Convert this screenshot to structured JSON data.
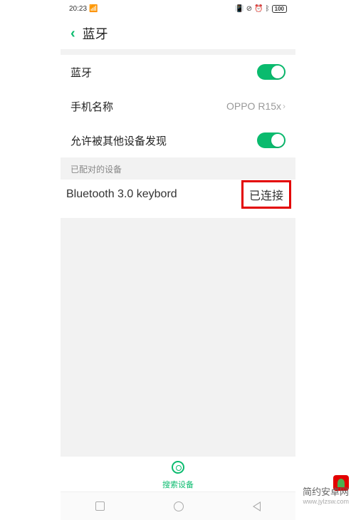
{
  "status_bar": {
    "time": "20:23",
    "battery": "100"
  },
  "header": {
    "title": "蓝牙"
  },
  "settings": {
    "bluetooth_label": "蓝牙",
    "phone_name_label": "手机名称",
    "phone_name_value": "OPPO R15x",
    "discoverable_label": "允许被其他设备发现"
  },
  "paired_section": {
    "header": "已配对的设备",
    "device_name": "Bluetooth 3.0 keybord",
    "device_status": "已连接"
  },
  "bottom": {
    "search_label": "搜索设备"
  },
  "watermark": {
    "text": "简约安卓网",
    "url": "www.jylzsw.com"
  }
}
